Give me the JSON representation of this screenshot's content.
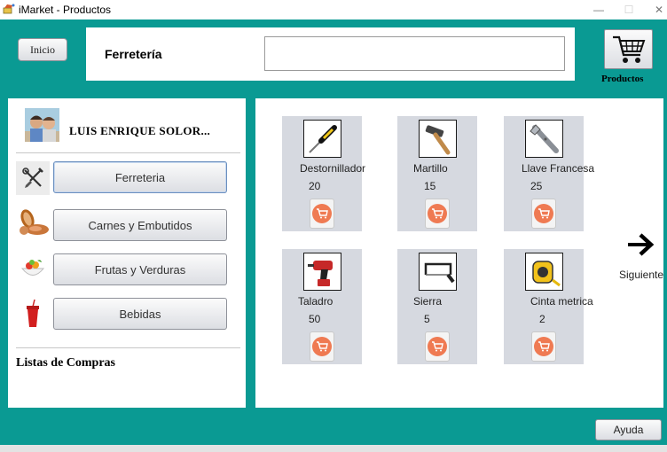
{
  "window": {
    "title": "iMarket - Productos",
    "minimize": "—",
    "maximize": "☐",
    "close": "✕"
  },
  "header": {
    "home_label": "Inicio",
    "category_title": "Ferretería",
    "search": {
      "value": "",
      "placeholder": ""
    },
    "products_label": "Productos"
  },
  "user": {
    "name": "LUIS ENRIQUE  SOLOR..."
  },
  "categories": [
    {
      "label": "Ferreteria",
      "icon": "tools-icon",
      "active": true
    },
    {
      "label": "Carnes y Embutidos",
      "icon": "meat-icon",
      "active": false
    },
    {
      "label": "Frutas y Verduras",
      "icon": "fruit-bowl-icon",
      "active": false
    },
    {
      "label": "Bebidas",
      "icon": "soda-cup-icon",
      "active": false
    }
  ],
  "lists_title": "Listas de Compras",
  "products": [
    {
      "name": "Destornillador",
      "qty": "20",
      "icon": "screwdriver-icon"
    },
    {
      "name": "Martillo",
      "qty": "15",
      "icon": "hammer-icon"
    },
    {
      "name": "Llave Francesa",
      "qty": "25",
      "icon": "wrench-icon"
    },
    {
      "name": "Taladro",
      "qty": "50",
      "icon": "drill-icon"
    },
    {
      "name": "Sierra",
      "qty": "5",
      "icon": "saw-icon"
    },
    {
      "name": "Cinta metrica",
      "qty": "2",
      "icon": "tape-measure-icon"
    }
  ],
  "next_label": "Siguiente",
  "help_label": "Ayuda",
  "colors": {
    "frame": "#0a9a93",
    "card": "#d6d9e0",
    "add_button": "#ef7a52"
  }
}
